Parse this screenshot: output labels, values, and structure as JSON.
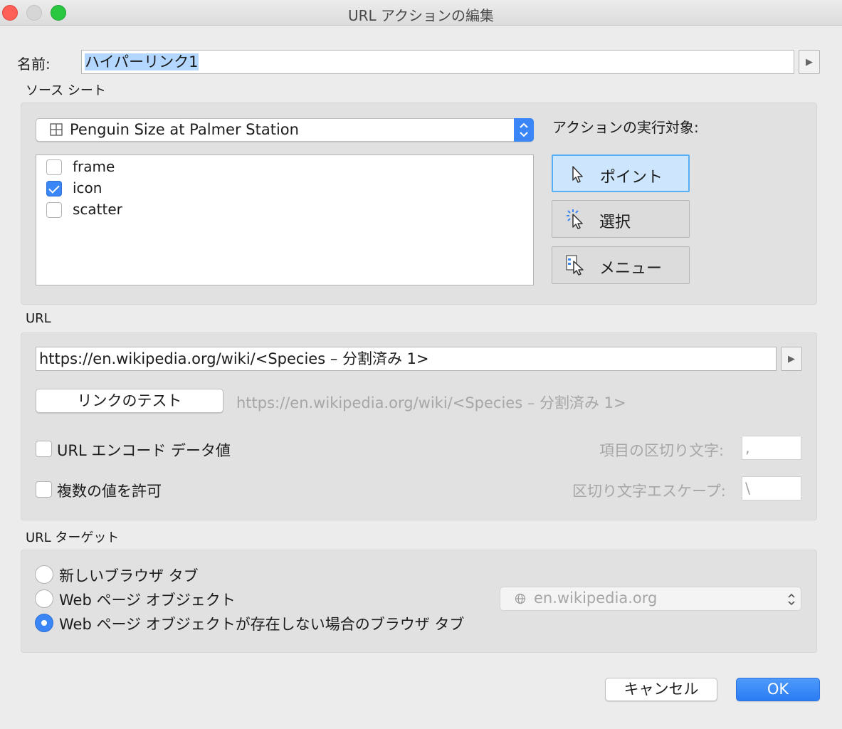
{
  "window": {
    "title": "URL アクションの編集"
  },
  "name": {
    "label": "名前:",
    "value": "ハイパーリンク1"
  },
  "source": {
    "section_label": "ソース シート",
    "sheet": "Penguin Size at Palmer Station",
    "items": [
      {
        "label": "frame",
        "checked": false
      },
      {
        "label": "icon",
        "checked": true
      },
      {
        "label": "scatter",
        "checked": false
      }
    ],
    "run_on_label": "アクションの実行対象:",
    "actions": [
      {
        "label": "ポイント",
        "icon": "pointer-icon",
        "selected": true
      },
      {
        "label": "選択",
        "icon": "select-pointer-icon",
        "selected": false
      },
      {
        "label": "メニュー",
        "icon": "menu-pointer-icon",
        "selected": false
      }
    ]
  },
  "url": {
    "section_label": "URL",
    "value": "https://en.wikipedia.org/wiki/<Species – 分割済み 1>",
    "test_button": "リンクのテスト",
    "preview": "https://en.wikipedia.org/wiki/<Species – 分割済み 1>",
    "encode_label": "URL エンコード データ値",
    "allow_multiple_label": "複数の値を許可",
    "item_delimiter_label": "項目の区切り文字:",
    "item_delimiter_value": ",",
    "escape_label": "区切り文字エスケープ:",
    "escape_value": "\\"
  },
  "target": {
    "section_label": "URL ターゲット",
    "options": [
      {
        "label": "新しいブラウザ タブ",
        "selected": false
      },
      {
        "label": "Web ページ オブジェクト",
        "selected": false
      },
      {
        "label": "Web ページ オブジェクトが存在しない場合のブラウザ タブ",
        "selected": true
      }
    ],
    "web_object": "en.wikipedia.org"
  },
  "footer": {
    "cancel": "キャンセル",
    "ok": "OK"
  },
  "colors": {
    "accent": "#3a86f7",
    "selected_action_bg": "#cde6fd"
  }
}
